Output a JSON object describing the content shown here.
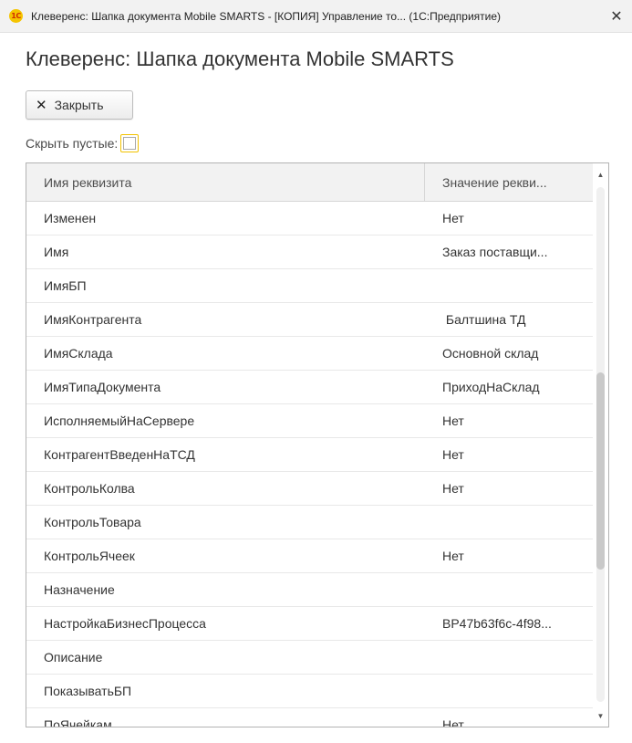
{
  "window": {
    "logo_text": "1С",
    "title": "Клеверенс: Шапка документа Mobile SMARTS - [КОПИЯ] Управление то... (1С:Предприятие)",
    "close_glyph": "✕"
  },
  "page": {
    "title": "Клеверенс: Шапка документа Mobile SMARTS"
  },
  "toolbar": {
    "close_label": "Закрыть",
    "close_icon": "close-icon"
  },
  "filter": {
    "hide_empty_label": "Скрыть пустые:",
    "hide_empty_checked": false
  },
  "table": {
    "columns": [
      "Имя реквизита",
      "Значение рекви..."
    ],
    "rows": [
      {
        "name": "Изменен",
        "value": "Нет"
      },
      {
        "name": "Имя",
        "value": "Заказ поставщи..."
      },
      {
        "name": "ИмяБП",
        "value": ""
      },
      {
        "name": "ИмяКонтрагента",
        "value": " Балтшина ТД"
      },
      {
        "name": "ИмяСклада",
        "value": "Основной склад"
      },
      {
        "name": "ИмяТипаДокумента",
        "value": "ПриходНаСклад"
      },
      {
        "name": "ИсполняемыйНаСервере",
        "value": "Нет"
      },
      {
        "name": "КонтрагентВведенНаТСД",
        "value": "Нет"
      },
      {
        "name": "КонтрольКолва",
        "value": "Нет"
      },
      {
        "name": "КонтрольТовара",
        "value": ""
      },
      {
        "name": "КонтрольЯчеек",
        "value": "Нет"
      },
      {
        "name": "Назначение",
        "value": ""
      },
      {
        "name": "НастройкаБизнесПроцесса",
        "value": "BP47b63f6c-4f98..."
      },
      {
        "name": "Описание",
        "value": ""
      },
      {
        "name": "ПоказыватьБП",
        "value": ""
      },
      {
        "name": "ПоЯчейкам",
        "value": "Нет"
      }
    ]
  },
  "scrollbar": {
    "up_glyph": "▲",
    "down_glyph": "▼"
  },
  "colors": {
    "accent_checkbox": "#f2c200",
    "header_bg": "#f2f2f2",
    "text": "#333333"
  }
}
